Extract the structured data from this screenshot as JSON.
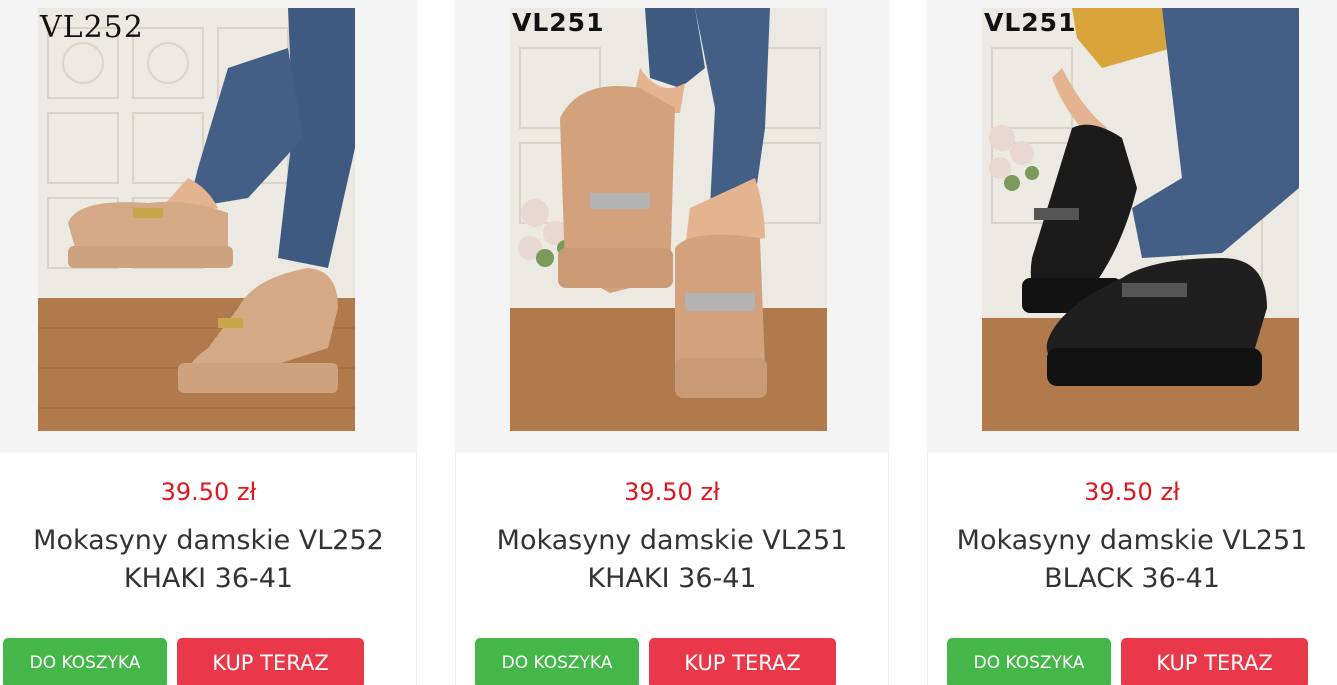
{
  "products": [
    {
      "code_label": "VL252",
      "price": "39.50 zł",
      "title_line1": "Mokasyny damskie VL252",
      "title_line2": "KHAKI 36-41",
      "cart_label": "DO KOSZYKA",
      "buy_label": "KUP TERAZ",
      "shoe_color": "#d5a985",
      "image_alt": "Beige loafer shoes on feet"
    },
    {
      "code_label": "VL251",
      "price": "39.50 zł",
      "title_line1": "Mokasyny damskie VL251",
      "title_line2": "KHAKI 36-41",
      "cart_label": "DO KOSZYKA",
      "buy_label": "KUP TERAZ",
      "shoe_color": "#d3a27c",
      "image_alt": "Khaki chunky loafer shoes on feet"
    },
    {
      "code_label": "VL251",
      "price": "39.50 zł",
      "title_line1": "Mokasyny damskie VL251",
      "title_line2": "BLACK 36-41",
      "cart_label": "DO KOSZYKA",
      "buy_label": "KUP TERAZ",
      "shoe_color": "#1b1b1b",
      "image_alt": "Black chunky loafer shoes on feet"
    }
  ],
  "colors": {
    "price": "#e0161f",
    "cart_button": "#45b649",
    "buy_button": "#e8384a",
    "jeans": "#3e5a80",
    "wall": "#ece8e2",
    "floor": "#b07a4c"
  }
}
